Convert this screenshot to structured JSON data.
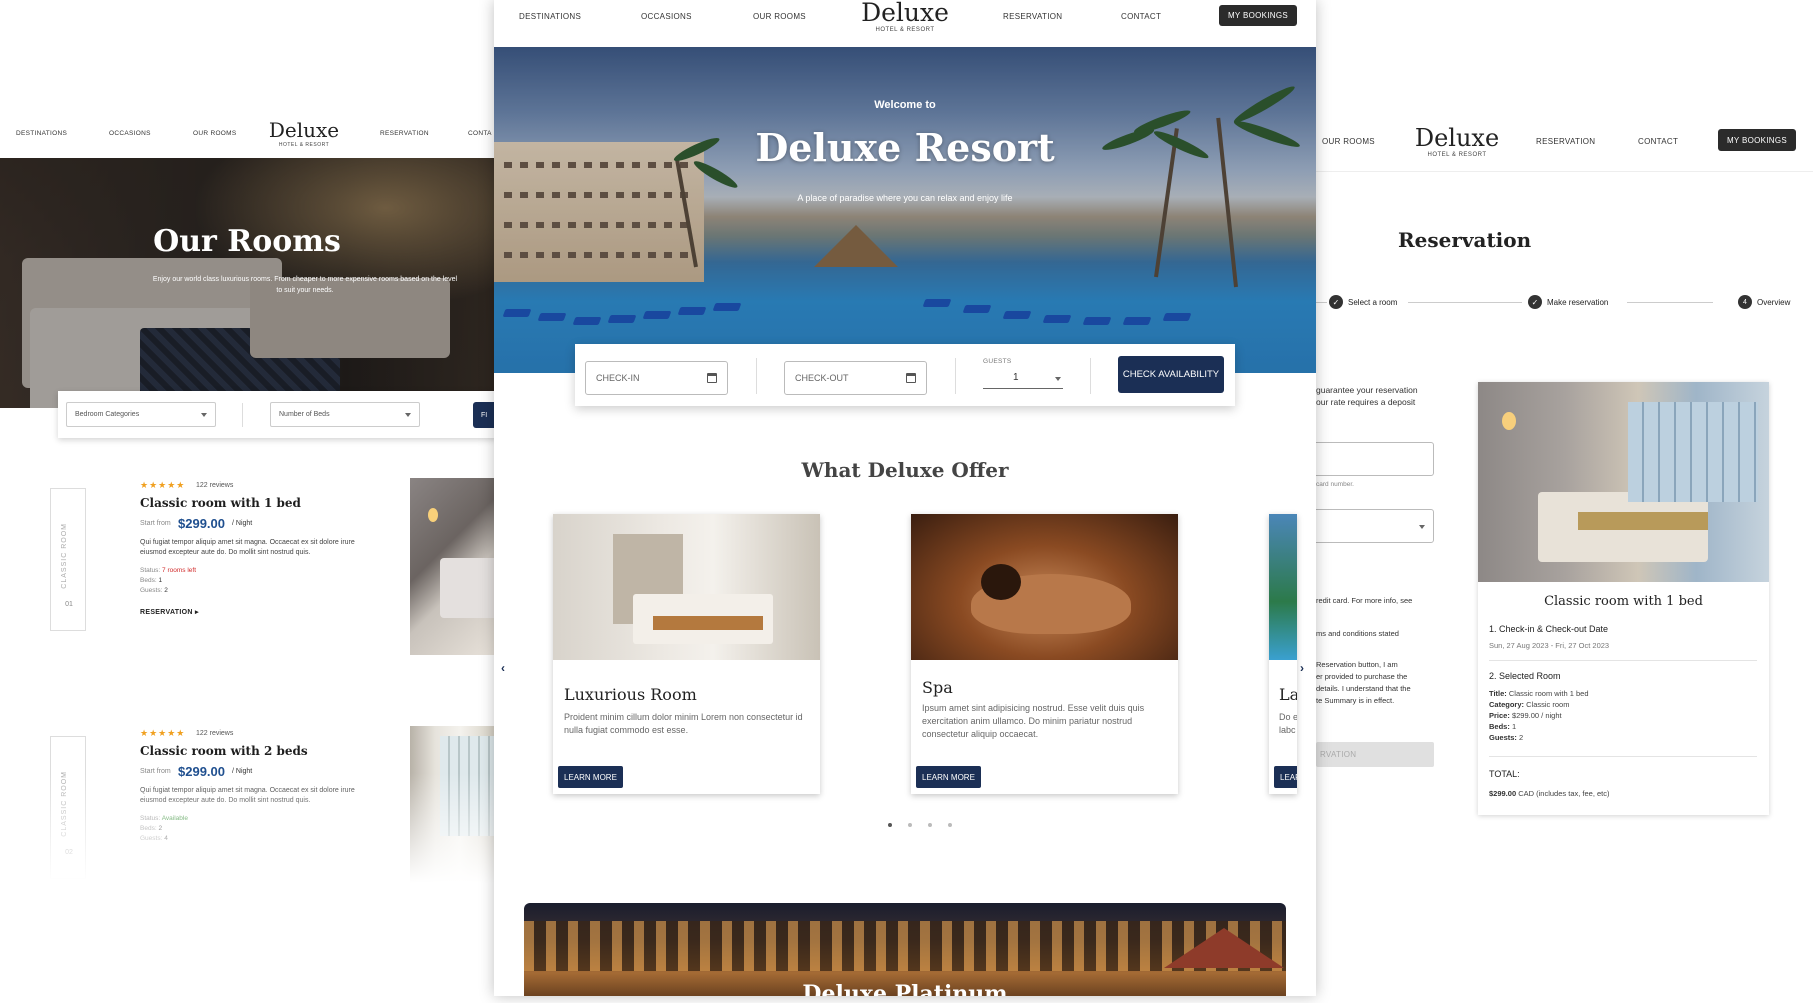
{
  "brand": {
    "name": "Deluxe",
    "tagline": "HOTEL & RESORT"
  },
  "nav": {
    "destinations": "DESTINATIONS",
    "occasions": "OCCASIONS",
    "our_rooms": "OUR ROOMS",
    "reservation": "RESERVATION",
    "contact": "CONTACT",
    "left_contact_partial": "CONTA",
    "my_bookings": "MY BOOKINGS"
  },
  "rooms_page": {
    "hero_title": "Our Rooms",
    "hero_subtitle": "Enjoy our world class luxurious rooms. From cheaper to more expensive rooms based on the level to suit your needs.",
    "filters": {
      "bedroom_categories": "Bedroom Categories",
      "number_of_beds": "Number of Beds",
      "filter_button_partial": "FI"
    },
    "rooms": [
      {
        "side_label": "CLASSIC ROOM",
        "number": "01",
        "stars": "★★★★★",
        "reviews": "122 reviews",
        "title": "Classic room with 1 bed",
        "start_from": "Start from",
        "price": "$299.00",
        "per_night": "/ Night",
        "description": "Qui fugiat tempor aliquip amet sit magna. Occaecat ex sit dolore irure eiusmod excepteur aute do. Do mollit sint nostrud quis.",
        "status_label": "Status:",
        "status": "7 rooms left",
        "beds_label": "Beds:",
        "beds": "1",
        "guests_label": "Guests:",
        "guests": "2",
        "reservation_link": "RESERVATION ▸"
      },
      {
        "side_label": "CLASSIC ROOM",
        "number": "02",
        "stars": "★★★★★",
        "reviews": "122 reviews",
        "title": "Classic room with 2 beds",
        "start_from": "Start from",
        "price": "$299.00",
        "per_night": "/ Night",
        "description": "Qui fugiat tempor aliquip amet sit magna. Occaecat ex sit dolore irure eiusmod excepteur aute do. Do mollit sint nostrud quis.",
        "status_label": "Status:",
        "status": "Available",
        "beds_label": "Beds:",
        "beds": "2",
        "guests_label": "Guests:",
        "guests": "4"
      }
    ]
  },
  "home_page": {
    "welcome": "Welcome to",
    "title": "Deluxe Resort",
    "subtitle": "A place of paradise where you can relax and enjoy life",
    "booking": {
      "check_in": "CHECK-IN",
      "check_out": "CHECK-OUT",
      "guests_label": "GUESTS",
      "guests_value": "1",
      "check_availability": "CHECK AVAILABILITY"
    },
    "offer_title": "What Deluxe Offer",
    "offers": [
      {
        "title": "Luxurious Room",
        "description": "Proident minim cillum dolor minim Lorem non consectetur id nulla fugiat commodo est esse.",
        "button": "LEARN MORE"
      },
      {
        "title": "Spa",
        "description": "Ipsum amet sint adipisicing nostrud. Esse velit duis quis exercitation anim ullamco. Do minim pariatur nostrud consectetur aliquip occaecat.",
        "button": "LEARN MORE"
      },
      {
        "title": "La",
        "description": "Do e labc",
        "button": "LEAR"
      }
    ],
    "carousel_prev": "‹",
    "carousel_next": "›",
    "carousel_active_index": 0,
    "carousel_count": 4,
    "platinum_title": "Deluxe Platinum"
  },
  "reservation_page": {
    "title": "Reservation",
    "steps": [
      {
        "label": "Select a room",
        "state": "done"
      },
      {
        "label": "Make reservation",
        "state": "done"
      },
      {
        "label": "Overview",
        "state": "current",
        "number": "4"
      }
    ],
    "form": {
      "guarantee_text_1": "guarantee your reservation",
      "guarantee_text_2": "our rate requires a deposit",
      "card_hint": "card number.",
      "credit_card_info": "redit card. For more info, see",
      "terms_text": "ms and conditions stated",
      "agreement_1": "Reservation button, I am",
      "agreement_2": "er provided to purchase the",
      "agreement_3": "details. I understand that the",
      "agreement_4": "te Summary is in effect.",
      "submit_partial": "RVATION"
    },
    "summary": {
      "room_title": "Classic room with 1 bed",
      "section_1": "1. Check-in & Check-out Date",
      "dates": "Sun, 27 Aug 2023 - Fri, 27 Oct 2023",
      "section_2": "2. Selected Room",
      "title_label": "Title:",
      "title_value": "Classic room with 1 bed",
      "category_label": "Category:",
      "category_value": "Classic room",
      "price_label": "Price:",
      "price_value": "$299.00 / night",
      "beds_label": "Beds:",
      "beds_value": "1",
      "guests_label": "Guests:",
      "guests_value": "2",
      "total_label": "TOTAL:",
      "total_amount": "$299.00",
      "total_note": "CAD (includes tax, fee, etc)"
    }
  },
  "colors": {
    "navy": "#1b2f55",
    "price_blue": "#1f4f8f",
    "status_red": "#d12b2b",
    "status_green": "#2e8b2e",
    "star": "#f0a020"
  }
}
